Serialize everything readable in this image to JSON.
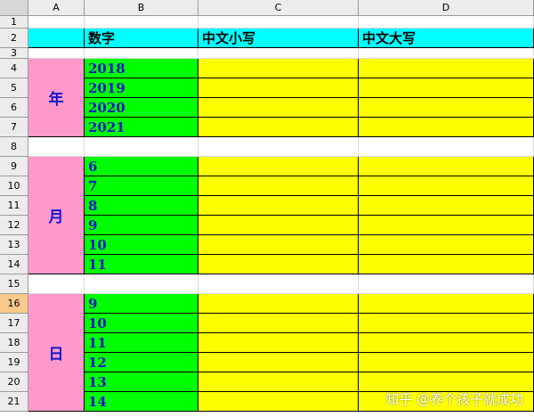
{
  "columns": [
    "A",
    "B",
    "C",
    "D"
  ],
  "rows": [
    "1",
    "2",
    "3",
    "4",
    "5",
    "6",
    "7",
    "8",
    "9",
    "10",
    "11",
    "12",
    "13",
    "14",
    "15",
    "16",
    "17",
    "18",
    "19",
    "20",
    "21"
  ],
  "selected_row": "16",
  "header_row": {
    "b": "数字",
    "c": "中文小写",
    "d": "中文大写"
  },
  "groups": [
    {
      "label": "年",
      "values": [
        "2018",
        "2019",
        "2020",
        "2021"
      ]
    },
    {
      "label": "月",
      "values": [
        "6",
        "7",
        "8",
        "9",
        "10",
        "11"
      ]
    },
    {
      "label": "日",
      "values": [
        "9",
        "10",
        "11",
        "12",
        "13",
        "14"
      ]
    }
  ],
  "watermark": "知乎 @养个孩子就成功",
  "colors": {
    "header_fill": "#00ffff",
    "label_fill": "#ff99cc",
    "number_fill": "#00ff00",
    "output_fill": "#ffff00",
    "number_text": "#1515c8"
  }
}
